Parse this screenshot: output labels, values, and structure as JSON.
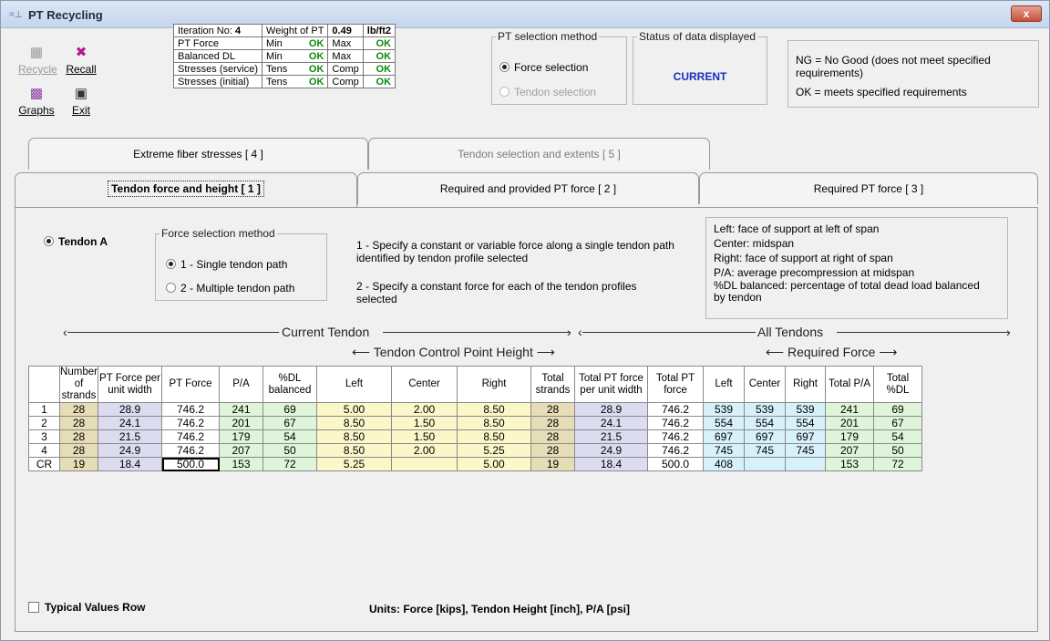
{
  "window": {
    "title": "PT Recycling",
    "close_label": "x"
  },
  "toolbar": {
    "recycle": "Recycle",
    "recall": "Recall",
    "graphs": "Graphs",
    "exit": "Exit"
  },
  "status_table": {
    "iteration_label": "Iteration No:",
    "iteration_value": "4",
    "weight_label": "Weight of PT",
    "weight_value": "0.49",
    "weight_unit": "lb/ft2",
    "rows": [
      {
        "label": "PT Force",
        "a": "Min",
        "a_val": "OK",
        "b": "Max",
        "b_val": "OK"
      },
      {
        "label": "Balanced DL",
        "a": "Min",
        "a_val": "OK",
        "b": "Max",
        "b_val": "OK"
      },
      {
        "label": "Stresses (service)",
        "a": "Tens",
        "a_val": "OK",
        "b": "Comp",
        "b_val": "OK"
      },
      {
        "label": "Stresses (initial)",
        "a": "Tens",
        "a_val": "OK",
        "b": "Comp",
        "b_val": "OK"
      }
    ]
  },
  "pt_selection": {
    "legend": "PT selection method",
    "option1": "Force selection",
    "option2": "Tendon selection"
  },
  "status_data": {
    "legend": "Status of data displayed",
    "value": "CURRENT"
  },
  "legend_box": {
    "ng": "NG = No Good (does not meet specified requirements)",
    "ok": "OK = meets specified requirements"
  },
  "tabs": {
    "extreme": "Extreme fiber stresses [ 4 ]",
    "tendon_sel": "Tendon selection and extents [ 5 ]",
    "force_height": "Tendon force and height [ 1 ]",
    "required_provided": "Required and provided PT force [ 2 ]",
    "required_pt": "Required PT force [ 3 ]"
  },
  "panel": {
    "tendon_label": "Tendon A",
    "force_method_legend": "Force selection method",
    "method1": "1 - Single tendon path",
    "method2": "2 - Multiple tendon path",
    "desc1": "1 - Specify a constant or variable force along a single tendon path identified by tendon profile selected",
    "desc2": "2 - Specify a constant force for each of the tendon profiles selected",
    "notes": [
      "Left: face of support at left of span",
      "Center: midspan",
      "Right: face of support at right of span",
      "P/A: average precompression at midspan",
      "%DL balanced: percentage of total dead load balanced by tendon"
    ],
    "current_tendon": "Current Tendon",
    "all_tendons": "All Tendons",
    "control_point": "Tendon Control Point Height",
    "required_force": "Required Force",
    "typical_values": "Typical Values Row",
    "units": "Units: Force [kips], Tendon Height [inch], P/A [psi]"
  },
  "grid": {
    "headers": [
      "",
      "Number of strands",
      "PT Force per unit width",
      "PT Force",
      "P/A",
      "%DL balanced",
      "Left",
      "Center",
      "Right",
      "Total strands",
      "Total PT force per unit width",
      "Total PT force",
      "Left",
      "Center",
      "Right",
      "Total P/A",
      "Total %DL"
    ],
    "rows": [
      [
        "1",
        "28",
        "28.9",
        "746.2",
        "241",
        "69",
        "5.00",
        "2.00",
        "8.50",
        "28",
        "28.9",
        "746.2",
        "539",
        "539",
        "539",
        "241",
        "69"
      ],
      [
        "2",
        "28",
        "24.1",
        "746.2",
        "201",
        "67",
        "8.50",
        "1.50",
        "8.50",
        "28",
        "24.1",
        "746.2",
        "554",
        "554",
        "554",
        "201",
        "67"
      ],
      [
        "3",
        "28",
        "21.5",
        "746.2",
        "179",
        "54",
        "8.50",
        "1.50",
        "8.50",
        "28",
        "21.5",
        "746.2",
        "697",
        "697",
        "697",
        "179",
        "54"
      ],
      [
        "4",
        "28",
        "24.9",
        "746.2",
        "207",
        "50",
        "8.50",
        "2.00",
        "5.25",
        "28",
        "24.9",
        "746.2",
        "745",
        "745",
        "745",
        "207",
        "50"
      ],
      [
        "CR",
        "19",
        "18.4",
        "500.0",
        "153",
        "72",
        "5.25",
        "",
        "5.00",
        "19",
        "18.4",
        "500.0",
        "408",
        "",
        "",
        "153",
        "72"
      ]
    ]
  }
}
